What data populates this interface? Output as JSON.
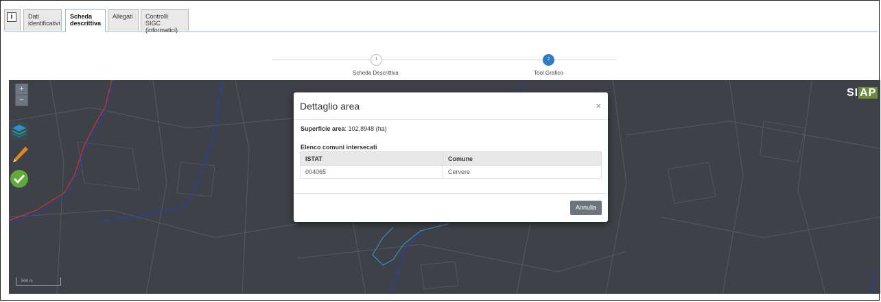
{
  "tabs": [
    {
      "line1": "Dati",
      "line2": "identificativi"
    },
    {
      "line1": "Scheda",
      "line2": "descrittiva"
    },
    {
      "line1": "Allegati",
      "line2": ""
    },
    {
      "line1": "Controlli SIGC",
      "line2": "(informatici)"
    }
  ],
  "info_tab_icon": "i",
  "active_tab": "Scheda descrittiva",
  "stepper": {
    "steps": [
      {
        "number": "1",
        "label": "Scheda Descrittiva",
        "state": "inactive"
      },
      {
        "number": "2",
        "label": "Tool Grafico",
        "state": "active"
      }
    ],
    "active_color": "#2e7cc3"
  },
  "map": {
    "zoom_in": "+",
    "zoom_out": "−",
    "logo": {
      "left": "SI",
      "right": "AP"
    },
    "scale_label": "500 m",
    "tools": [
      "layers-icon",
      "pencil-icon",
      "checkmark-icon"
    ]
  },
  "modal": {
    "title": "Dettaglio area",
    "close_glyph": "×",
    "area_label": "Superficie area",
    "area_value": ": 102,8948 (ha)",
    "list_title": "Elenco comuni intersecati",
    "columns": [
      "ISTAT",
      "Comune"
    ],
    "rows": [
      [
        "004065",
        "Cervere"
      ]
    ],
    "cancel_label": "Annulla"
  }
}
